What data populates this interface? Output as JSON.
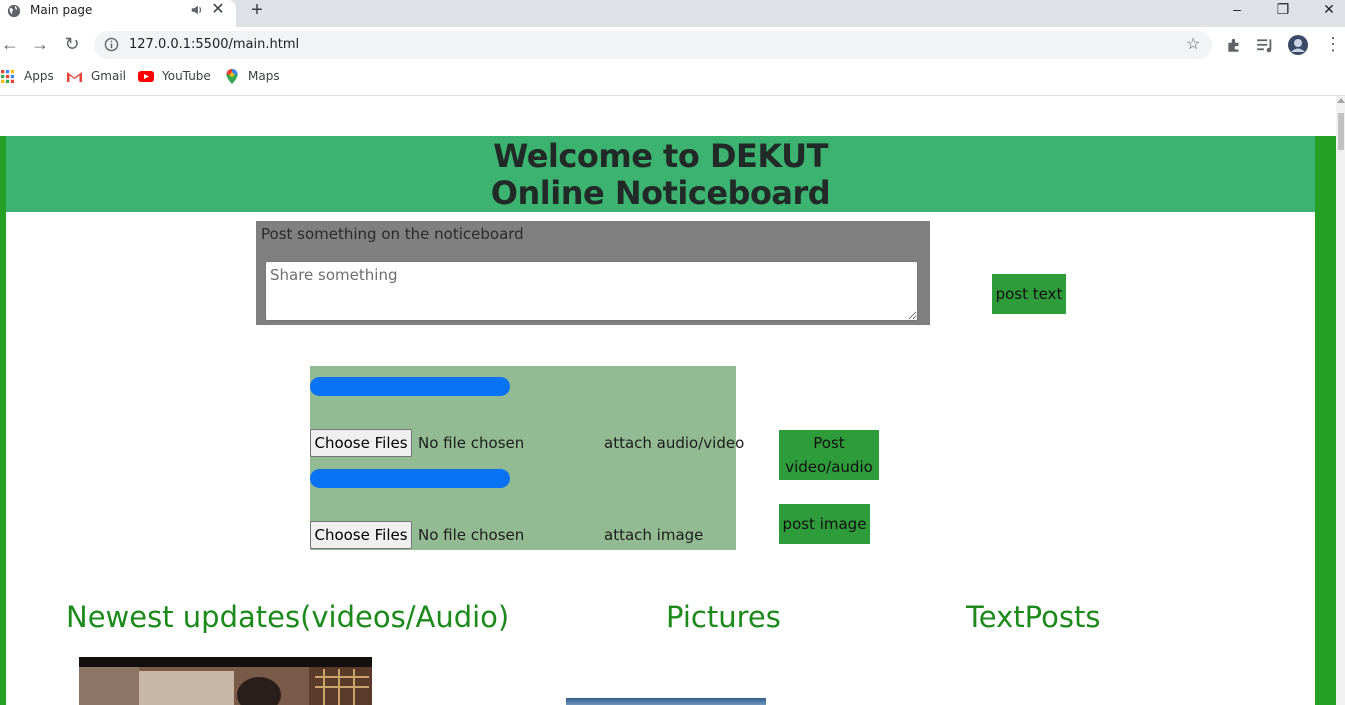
{
  "browser": {
    "tab_title": "Main page",
    "url": "127.0.0.1:5500/main.html",
    "bookmarks": [
      {
        "label": "Apps",
        "icon": "apps-grid-icon"
      },
      {
        "label": "Gmail",
        "icon": "gmail-icon"
      },
      {
        "label": "YouTube",
        "icon": "youtube-icon"
      },
      {
        "label": "Maps",
        "icon": "maps-icon"
      }
    ]
  },
  "header": {
    "title_line1": "Welcome to DEKUT",
    "title_line2": "Online Noticeboard"
  },
  "post_form": {
    "label": "Post something on the noticeboard",
    "placeholder": "Share something",
    "post_text_button": "post text"
  },
  "media_form": {
    "video": {
      "choose_label": "Choose Files",
      "file_status": "No file chosen",
      "attach_label": "attach audio/video",
      "post_button_line1": "Post",
      "post_button_line2": "video/audio"
    },
    "image": {
      "choose_label": "Choose Files",
      "file_status": "No file chosen",
      "attach_label": "attach image",
      "post_button": "post image"
    }
  },
  "sections": {
    "videos": "Newest updates(videos/Audio)",
    "pictures": "Pictures",
    "text_posts": "TextPosts"
  },
  "colors": {
    "frame_green": "#24a124",
    "header_green": "#3cb371",
    "button_green": "#2e9c3a",
    "media_panel": "#93bb93",
    "progress_blue": "#0a72f5",
    "section_text": "#1b8a1b"
  }
}
